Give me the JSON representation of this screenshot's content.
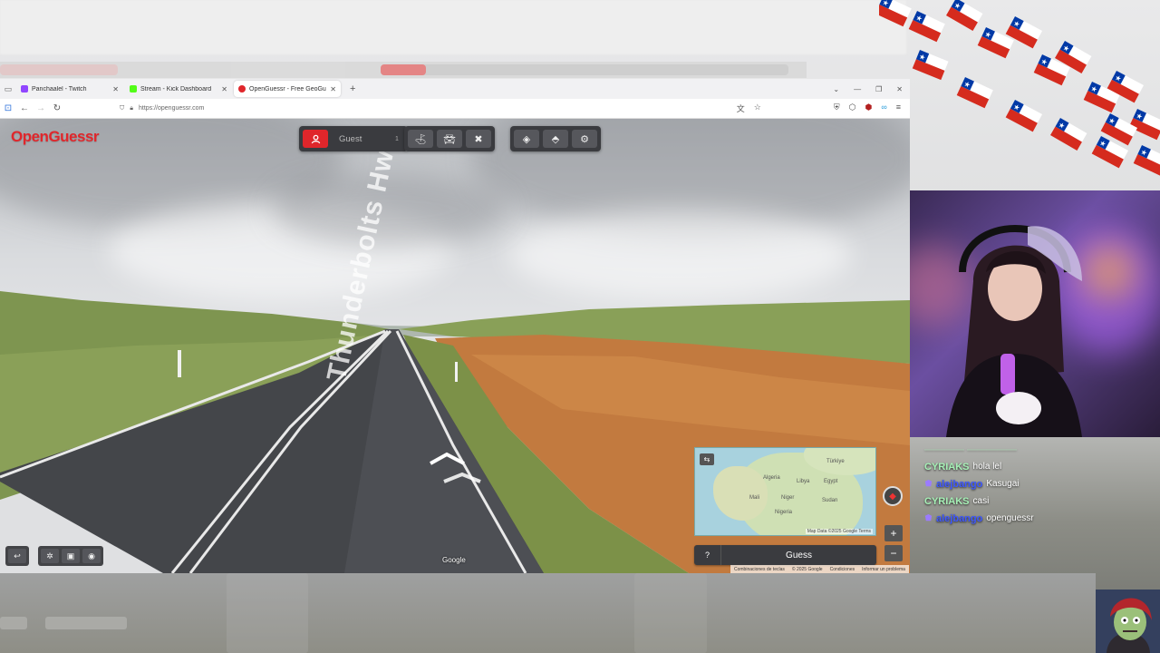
{
  "tabs": [
    {
      "label": "Panchaalel - Twitch",
      "color": "#9146ff",
      "active": false
    },
    {
      "label": "Stream - Kick Dashboard",
      "color": "#53fc18",
      "active": false
    },
    {
      "label": "OpenGuessr - Free GeoGuessr A",
      "color": "#e0262b",
      "active": true
    }
  ],
  "address": {
    "url": "https://openguessr.com"
  },
  "game": {
    "logo": "OpenGuessr",
    "guest_label": "Guest",
    "guest_count": "1",
    "road_label": "Thunderbolts Hwy",
    "google_watermark": "Google",
    "guess_label": "Guess",
    "help_label": "?",
    "zoom_in": "+",
    "zoom_out": "−",
    "map_attribution": "Map Data ©2025 Google  Terms",
    "map_footer": {
      "shortcuts": "Combinaciones de teclas",
      "copyright": "© 2025 Google",
      "conditions": "Condiciones",
      "report": "Informar un problema"
    },
    "map_labels": {
      "turkey": "Türkiye",
      "algeria": "Algeria",
      "libya": "Libya",
      "egypt": "Egypt",
      "mali": "Mali",
      "niger": "Niger",
      "nigeria": "Nigeria",
      "sudan": "Sudan"
    }
  },
  "chat": [
    {
      "user": "CYRIAKS",
      "message": "hola lel",
      "user_color": "#a6f0b6",
      "badge": false
    },
    {
      "user": "alejbango",
      "message": "Kasugai",
      "user_color": "#3d57ff",
      "badge": true
    },
    {
      "user": "CYRIAKS",
      "message": "casi",
      "user_color": "#a6f0b6",
      "badge": false
    },
    {
      "user": "alejbango",
      "message": "openguessr",
      "user_color": "#3d57ff",
      "badge": true
    }
  ],
  "colors": {
    "brand": "#e0262b",
    "toolbar_bg": "#3a3b3f"
  },
  "icons": {
    "user": "user-icon",
    "flag": "flag-icon",
    "car": "car-icon",
    "no_move": "no-move-icon",
    "layers": "layers-icon",
    "graduation": "graduation-icon",
    "settings": "gear-icon"
  }
}
